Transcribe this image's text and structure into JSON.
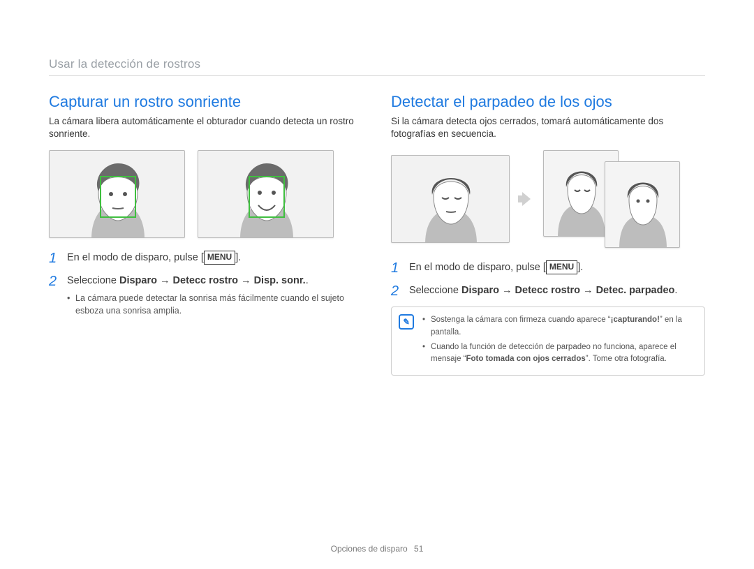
{
  "breadcrumb": "Usar la detección de rostros",
  "left": {
    "title": "Capturar un rostro sonriente",
    "lead": "La cámara libera automáticamente el obturador cuando detecta un rostro sonriente.",
    "steps": [
      {
        "num": "1",
        "pre": "En el modo de disparo, pulse [",
        "chip": "MENU",
        "post": "]."
      },
      {
        "num": "2",
        "text_parts": [
          "Seleccione ",
          "Disparo",
          " → ",
          "Detecc rostro",
          " → ",
          "Disp. sonr.",
          "."
        ],
        "bullets": [
          "La cámara puede detectar la sonrisa más fácilmente cuando el sujeto esboza una sonrisa amplia."
        ]
      }
    ]
  },
  "right": {
    "title": "Detectar el parpadeo de los ojos",
    "lead": "Si la cámara detecta ojos cerrados, tomará automáticamente dos fotografías en secuencia.",
    "steps": [
      {
        "num": "1",
        "pre": "En el modo de disparo, pulse [",
        "chip": "MENU",
        "post": "]."
      },
      {
        "num": "2",
        "text_parts": [
          "Seleccione ",
          "Disparo",
          " → ",
          "Detecc rostro",
          " → ",
          "Detec. parpadeo",
          "."
        ]
      }
    ],
    "notes": [
      {
        "pre": "Sostenga la cámara con firmeza cuando aparece “",
        "bold": "¡capturando!",
        "post": "” en la pantalla."
      },
      {
        "pre": "Cuando la función de detección de parpadeo no funciona, aparece el mensaje “",
        "bold": "Foto tomada con ojos cerrados",
        "post": "”. Tome otra fotografía."
      }
    ]
  },
  "footer": {
    "section": "Opciones de disparo",
    "page": "51"
  }
}
